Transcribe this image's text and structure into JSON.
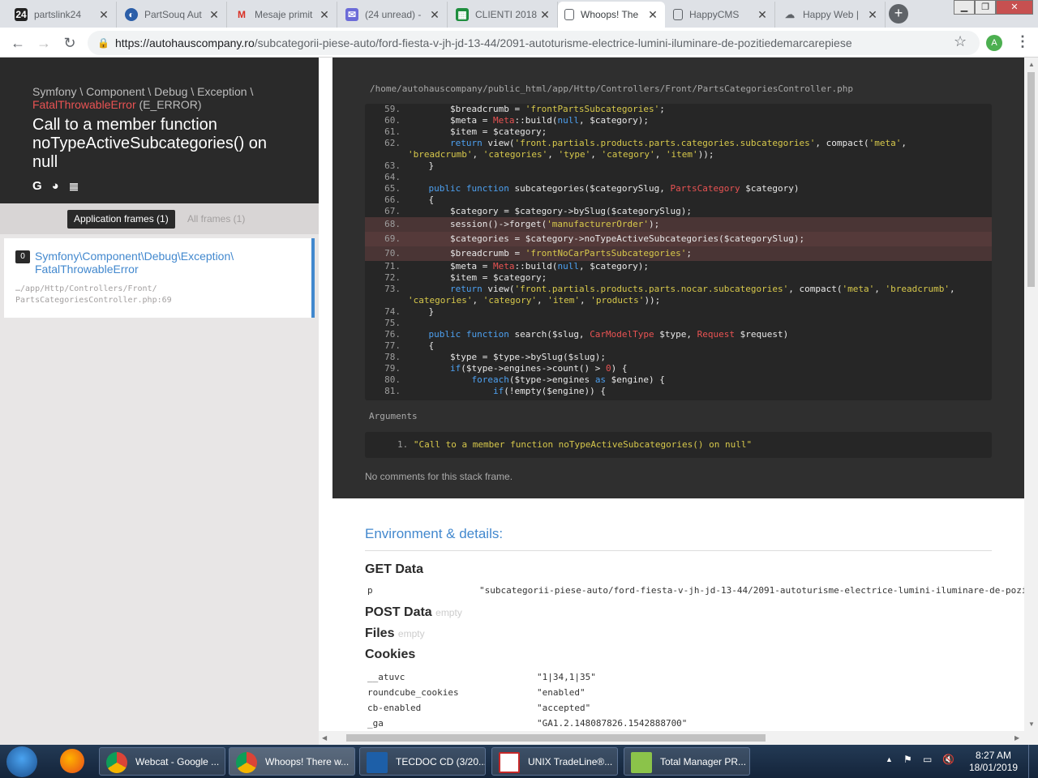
{
  "browser": {
    "tabs": [
      {
        "label": "partslink24",
        "icon": "partslink-icon"
      },
      {
        "label": "PartSouq Aut",
        "icon": "partsouq-icon"
      },
      {
        "label": "Mesaje primit",
        "icon": "gmail-icon"
      },
      {
        "label": "(24 unread) -",
        "icon": "mail-icon"
      },
      {
        "label": "CLIENTI 2018",
        "icon": "sheets-icon"
      },
      {
        "label": "Whoops! The",
        "icon": "page-icon"
      },
      {
        "label": "HappyCMS",
        "icon": "page-icon"
      },
      {
        "label": "Happy Web |",
        "icon": "cloud-icon"
      }
    ],
    "url_domain": "https://autohauscompany.ro",
    "url_path": "/subcategorii-piese-auto/ford-fiesta-v-jh-jd-13-44/2091-autoturisme-electrice-lumini-iluminare-de-pozitiedemarcarepiese",
    "profile_initial": "A"
  },
  "exception": {
    "class_path": "Symfony \\ Component \\ Debug \\ Exception \\",
    "class_name": "FatalThrowableError",
    "level": "(E_ERROR)",
    "message": "Call to a member function noTypeActiveSubcategories() on null"
  },
  "frames": {
    "app_label": "Application frames (1)",
    "all_label": "All frames (1)",
    "items": [
      {
        "index": "0",
        "class_line1": "Symfony\\Component\\Debug\\Exception\\",
        "class_line2": "FatalThrowableError",
        "file_line1": "…/app/Http/Controllers/Front/",
        "file_line2": "PartsCategoriesController.php:69"
      }
    ]
  },
  "code": {
    "file_path": "/home/autohauscompany/public_html/app/Http/Controllers/Front/PartsCategoriesController.php",
    "arguments_label": "Arguments",
    "argument_index": "1.",
    "argument_value": "\"Call to a member function noTypeActiveSubcategories() on null\"",
    "no_comments": "No comments for this stack frame."
  },
  "env": {
    "title": "Environment & details:",
    "get_title": "GET Data",
    "get_key": "p",
    "get_value": "\"subcategorii-piese-auto/ford-fiesta-v-jh-jd-13-44/2091-autoturisme-electrice-lumini-iluminare-de-pozi",
    "post_title": "POST Data",
    "files_title": "Files",
    "empty_label": "empty",
    "cookies_title": "Cookies",
    "cookies": [
      {
        "key": "__atuvc",
        "value": "\"1|34,1|35\""
      },
      {
        "key": "roundcube_cookies",
        "value": "\"enabled\""
      },
      {
        "key": "cb-enabled",
        "value": "\"accepted\""
      },
      {
        "key": "_ga",
        "value": "\"GA1.2.148087826.1542888700\""
      }
    ]
  },
  "taskbar": {
    "items": [
      {
        "label": "Webcat - Google ...",
        "icon": "chrome-icon"
      },
      {
        "label": "Whoops! There w...",
        "icon": "chrome-icon"
      },
      {
        "label": "TECDOC CD (3/20...",
        "icon": "tecdoc-icon"
      },
      {
        "label": "UNIX TradeLine®...",
        "icon": "unix-icon"
      },
      {
        "label": "Total Manager PR...",
        "icon": "total-manager-icon"
      }
    ],
    "time": "8:27 AM",
    "date": "18/01/2019"
  }
}
